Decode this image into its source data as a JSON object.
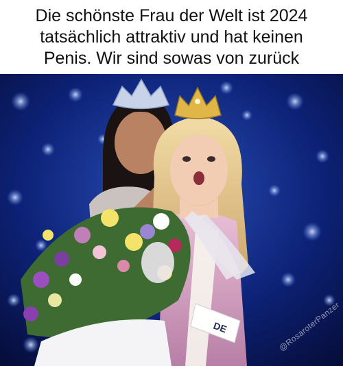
{
  "caption": {
    "lines": [
      "Die schönste Frau der Welt ist 2024",
      "tatsächlich attraktiv und hat keinen",
      "Penis. Wir sind sowas von zurück"
    ]
  },
  "photo": {
    "watermark": "@RosaroterPanzer",
    "sash_text": "DE",
    "colors": {
      "stage_blue": "#0a1a5c",
      "light_blue": "#7fb4ff",
      "hair_blonde": "#e9c98a",
      "gown_pink": "#d7a8c4",
      "crown_gold": "#d9b04a"
    }
  }
}
